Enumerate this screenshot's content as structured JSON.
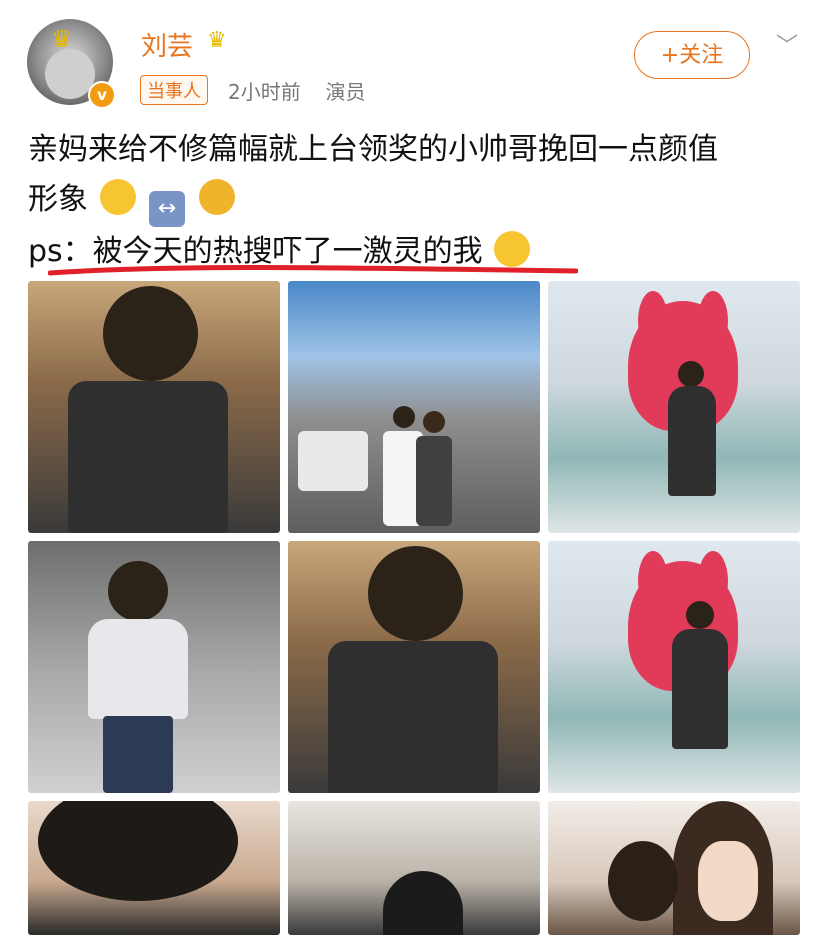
{
  "user": {
    "name": "刘芸",
    "tag": "当事人",
    "time": "2小时前",
    "role": "演员"
  },
  "follow_label": "+关注",
  "post": {
    "line1": "亲妈来给不修篇幅就上台领奖的小帅哥挽回一点颜值",
    "line2": "形象",
    "line3": "ps：被今天的热搜吓了一激灵的我"
  },
  "icons": {
    "verified": "v-badge-icon",
    "crown": "crown-icon",
    "chevron": "chevron-down-icon",
    "emoji1": "smile-emoji-icon",
    "emoji2": "left-right-arrow-emoji-icon",
    "emoji3": "rofl-emoji-icon",
    "emoji4": "silly-face-emoji-icon"
  },
  "colors": {
    "accent": "#e8741f",
    "underline": "#e0202a",
    "meta": "#777777"
  },
  "photos": [
    "photo-1",
    "photo-2",
    "photo-3",
    "photo-4",
    "photo-5",
    "photo-6",
    "photo-7",
    "photo-8",
    "photo-9"
  ]
}
